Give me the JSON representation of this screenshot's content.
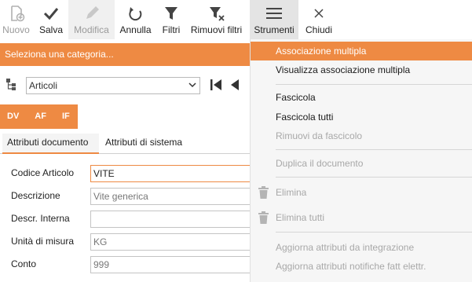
{
  "toolbar": {
    "nuovo": "Nuovo",
    "salva": "Salva",
    "modifica": "Modifica",
    "annulla": "Annulla",
    "filtri": "Filtri",
    "rimuovi_filtri": "Rimuovi filtri",
    "strumenti": "Strumenti",
    "chiudi": "Chiudi"
  },
  "category_bar": "Seleziona una categoria...",
  "selector": {
    "value": "Articoli"
  },
  "badges": [
    "DV",
    "AF",
    "IF"
  ],
  "attr_tabs": [
    "Attributi documento",
    "Attributi di sistema"
  ],
  "form": {
    "fields": [
      {
        "label": "Codice Articolo",
        "value": "VITE"
      },
      {
        "label": "Descrizione",
        "value": "Vite generica"
      },
      {
        "label": "Descr. Interna",
        "value": ""
      },
      {
        "label": "Unità di misura",
        "value": "KG"
      },
      {
        "label": "Conto",
        "value": "999"
      }
    ]
  },
  "menu": {
    "items": [
      {
        "label": "Associazione multipla",
        "state": "highlighted"
      },
      {
        "label": "Visualizza associazione multipla",
        "state": "enabled"
      },
      {
        "label": "Fascicola",
        "state": "enabled"
      },
      {
        "label": "Fascicola tutti",
        "state": "enabled"
      },
      {
        "label": "Rimuovi da fascicolo",
        "state": "disabled"
      },
      {
        "label": "Duplica il documento",
        "state": "disabled"
      },
      {
        "label": "Elimina",
        "state": "disabled",
        "icon": "trash-icon"
      },
      {
        "label": "Elimina tutti",
        "state": "disabled",
        "icon": "trash-icon"
      },
      {
        "label": "Aggiorna attributi da integrazione",
        "state": "disabled"
      },
      {
        "label": "Aggiorna attributi notifiche fatt elettr.",
        "state": "disabled"
      }
    ]
  },
  "colors": {
    "accent": "#ee8a43",
    "disabled_text": "#a8a8a8"
  }
}
